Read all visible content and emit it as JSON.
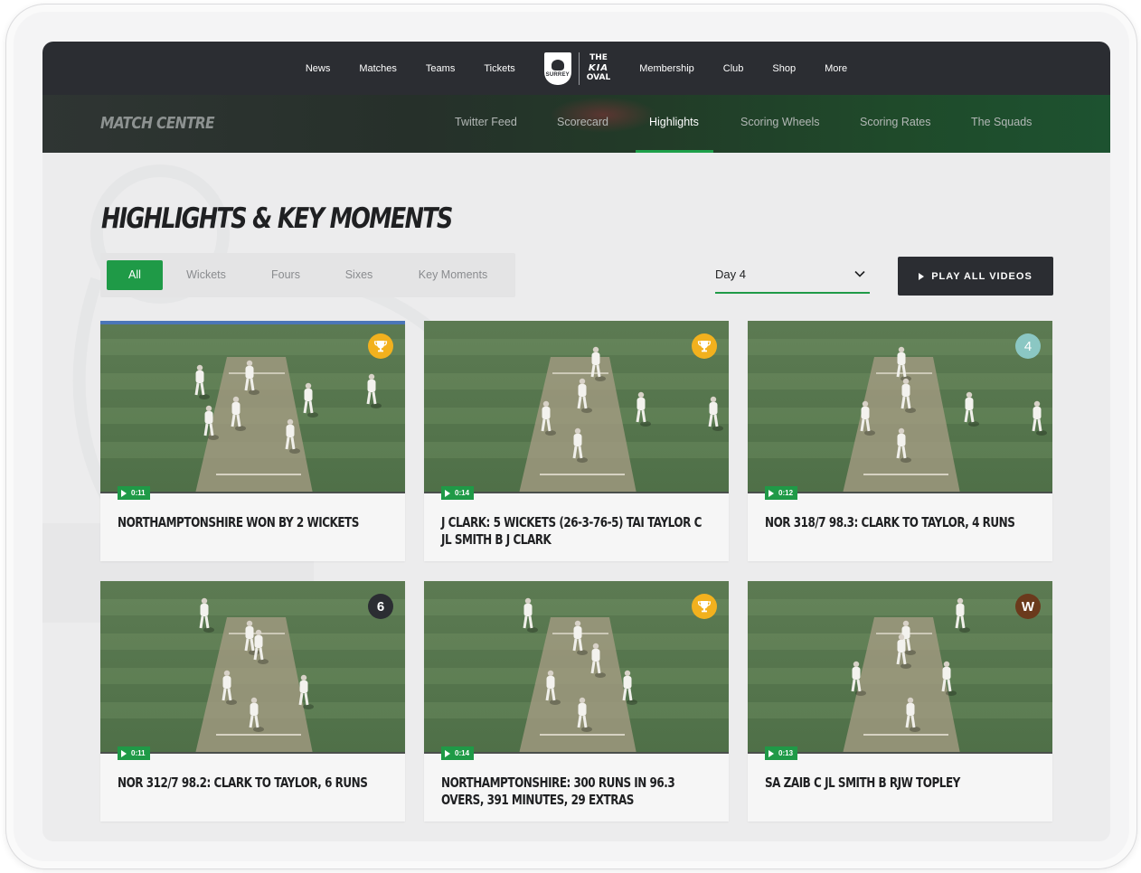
{
  "top_nav": {
    "left_links": [
      "News",
      "Matches",
      "Teams",
      "Tickets"
    ],
    "logo": {
      "crest_text": "SURREY",
      "venue_line1": "THE",
      "venue_line2": "KIA",
      "venue_line3": "OVAL"
    },
    "right_links": [
      "Membership",
      "Club",
      "Shop",
      "More"
    ]
  },
  "sub_nav": {
    "section_title": "MATCH CENTRE",
    "tabs": [
      "Twitter Feed",
      "Scorecard",
      "Highlights",
      "Scoring Wheels",
      "Scoring Rates",
      "The Squads"
    ],
    "active_tab": "Highlights"
  },
  "page_title": "HIGHLIGHTS & KEY MOMENTS",
  "filters": {
    "options": [
      "All",
      "Wickets",
      "Fours",
      "Sixes",
      "Key Moments"
    ],
    "active": "All"
  },
  "day_select": {
    "value": "Day 4"
  },
  "play_all_label": "PLAY ALL VIDEOS",
  "videos": [
    {
      "duration": "0:11",
      "badge": "trophy",
      "title": "NORTHAMPTONSHIRE WON BY 2 WICKETS"
    },
    {
      "duration": "0:14",
      "badge": "trophy",
      "title": "J CLARK: 5 WICKETS (26-3-76-5) TAI TAYLOR C JL SMITH B J CLARK"
    },
    {
      "duration": "0:12",
      "badge": "4",
      "title": "NOR 318/7 98.3: CLARK TO TAYLOR, 4 RUNS"
    },
    {
      "duration": "0:11",
      "badge": "6",
      "title": "NOR 312/7 98.2: CLARK TO TAYLOR, 6 RUNS"
    },
    {
      "duration": "0:14",
      "badge": "trophy",
      "title": "NORTHAMPTONSHIRE: 300 RUNS IN 96.3 OVERS, 391 MINUTES, 29 EXTRAS"
    },
    {
      "duration": "0:13",
      "badge": "W",
      "title": "SA ZAIB C JL SMITH B RJW TOPLEY"
    }
  ],
  "colors": {
    "accent_green": "#1f9a47",
    "nav_dark": "#2b2d32",
    "trophy_badge": "#f2b11e",
    "four_badge": "#8bc7c3",
    "six_badge": "#2b2d32",
    "wicket_badge": "#6b3a1c"
  }
}
